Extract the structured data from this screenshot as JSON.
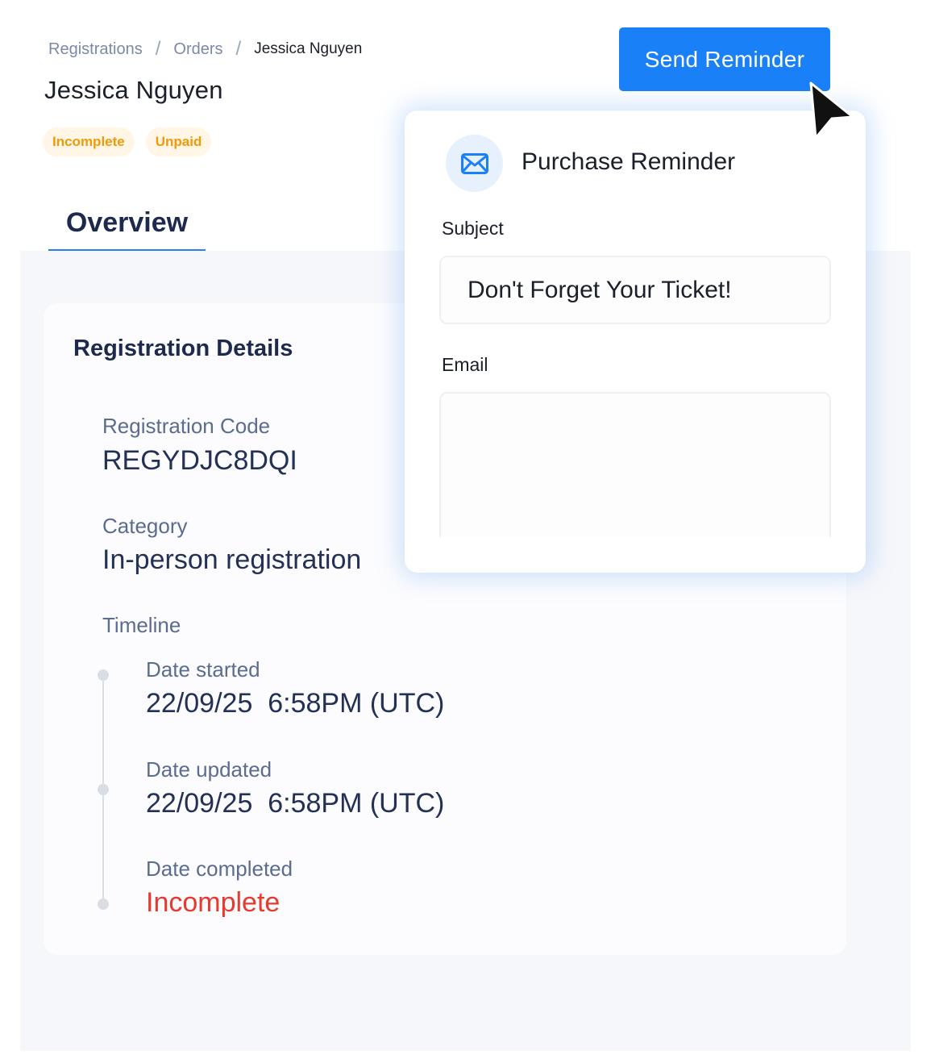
{
  "breadcrumb": {
    "items": [
      "Registrations",
      "Orders"
    ],
    "separator": "/",
    "current": "Jessica Nguyen"
  },
  "header": {
    "title": "Jessica Nguyen",
    "badges": [
      "Incomplete",
      "Unpaid"
    ],
    "send_button_label": "Send Reminder"
  },
  "tabs": [
    {
      "label": "Overview",
      "active": true
    }
  ],
  "details": {
    "title": "Registration Details",
    "registration_code_label": "Registration Code",
    "registration_code": "REGYDJC8DQI",
    "category_label": "Category",
    "category": "In-person registration",
    "timeline_label": "Timeline",
    "timeline": [
      {
        "label": "Date started",
        "value": "22/09/25  6:58PM (UTC)"
      },
      {
        "label": "Date updated",
        "value": "22/09/25  6:58PM (UTC)"
      },
      {
        "label": "Date completed",
        "value": "Incomplete"
      }
    ]
  },
  "popover": {
    "icon": "envelope-icon",
    "title": "Purchase Reminder",
    "subject_label": "Subject",
    "subject_value": "Don't Forget Your Ticket!",
    "email_label": "Email",
    "email_value": ""
  },
  "colors": {
    "primary": "#1a80f7",
    "badge_text": "#f09a0a",
    "badge_bg": "#fff6e6",
    "incomplete": "#e63a2e",
    "tab_underline": "#2f7ef0"
  }
}
